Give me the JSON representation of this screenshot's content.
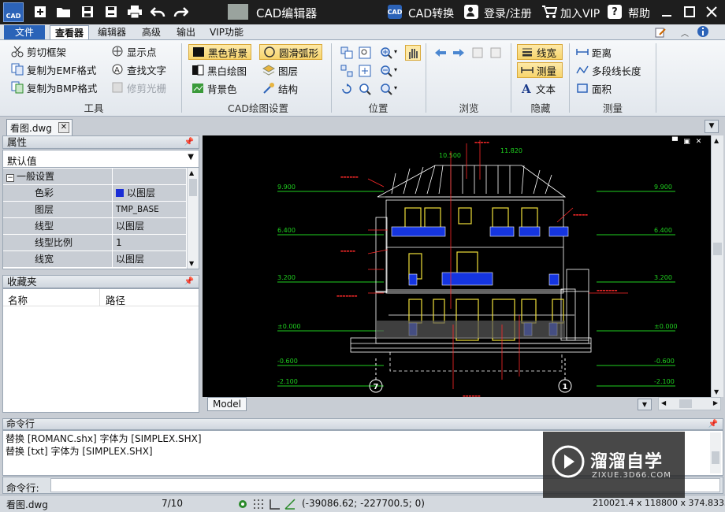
{
  "titlebar": {
    "app_logo": "CAD",
    "title": "CAD编辑器",
    "cad_convert_badge": "CAD",
    "cad_convert": "CAD转换",
    "login": "登录/注册",
    "vip": "加入VIP",
    "help_badge": "?",
    "help": "帮助"
  },
  "menubar": {
    "items": [
      "文件",
      "查看器",
      "编辑器",
      "高级",
      "输出",
      "VIP功能"
    ]
  },
  "ribbon": {
    "tools": {
      "label": "工具",
      "clip_frame": "剪切框架",
      "copy_emf": "复制为EMF格式",
      "copy_bmp": "复制为BMP格式",
      "show_points": "显示点",
      "find_text": "查找文字",
      "trim_raster": "修剪光栅"
    },
    "draw_settings": {
      "label": "CAD绘图设置",
      "black_bg": "黑色背景",
      "smooth_arc": "圆滑弧形",
      "bw_drawing": "黑白绘图",
      "layers": "图层",
      "bg_color": "背景色",
      "structure": "结构"
    },
    "position": {
      "label": "位置"
    },
    "browse": {
      "label": "浏览"
    },
    "hide": {
      "label": "隐藏",
      "line_width": "线宽",
      "measure": "测量",
      "text": "文本"
    },
    "measure": {
      "label": "测量",
      "distance": "距离",
      "polyline_length": "多段线长度",
      "area": "面积"
    }
  },
  "doc_tab": {
    "name": "看图.dwg"
  },
  "properties": {
    "title": "属性",
    "selector": "默认值",
    "section": "一般设置",
    "rows": [
      {
        "key": "色彩",
        "value": "以图层"
      },
      {
        "key": "图层",
        "value": "TMP_BASE"
      },
      {
        "key": "线型",
        "value": "以图层"
      },
      {
        "key": "线型比例",
        "value": "1"
      },
      {
        "key": "线宽",
        "value": "以图层"
      }
    ],
    "color_swatch": "#1a2dd6"
  },
  "favorites": {
    "title": "收藏夹",
    "col_name": "名称",
    "col_path": "路径"
  },
  "drawing": {
    "elevations_left": [
      "9.900",
      "6.400",
      "3.200",
      "±0.000",
      "-0.600",
      "-2.100"
    ],
    "elevations_right": [
      "9.900",
      "6.400",
      "3.200",
      "±0.000",
      "-0.600",
      "-2.100"
    ],
    "top_dims": [
      "10.500",
      "11.820"
    ],
    "axis_left": "7",
    "axis_right": "1",
    "colors": {
      "bg": "#000000",
      "green": "#1fd11f",
      "white": "#ffffff",
      "yellow": "#f0e03a",
      "blue": "#1535e0",
      "red": "#ff2a2a"
    }
  },
  "model_tab": "Model",
  "command": {
    "title": "命令行",
    "lines": [
      "替换 [ROMANC.shx] 字体为 [SIMPLEX.SHX]",
      "替换 [txt] 字体为 [SIMPLEX.SHX]"
    ],
    "prompt": "命令行:"
  },
  "status": {
    "file": "看图.dwg",
    "page": "7/10",
    "coords": "(-39086.62; -227700.5; 0)",
    "dims": "210021.4 x 118800 x 374.8333"
  },
  "watermark": {
    "title": "溜溜自学",
    "sub": "ZIXUE.3D66.COM"
  }
}
